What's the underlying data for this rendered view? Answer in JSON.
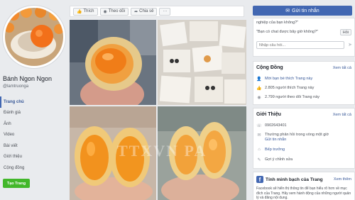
{
  "page": {
    "name": "Bánh Ngon Ngon",
    "handle": "@lamtruonga"
  },
  "nav": {
    "items": [
      {
        "label": "Trang chủ",
        "active": true
      },
      {
        "label": "Đánh giá"
      },
      {
        "label": "Ảnh"
      },
      {
        "label": "Video"
      },
      {
        "label": "Bài viết"
      },
      {
        "label": "Giới thiệu"
      },
      {
        "label": "Cộng đồng"
      }
    ],
    "create_button": "Tạo Trang"
  },
  "actions": {
    "like": "Thích",
    "follow": "Theo dõi",
    "share": "Chia sẻ",
    "more": "···"
  },
  "watermark": "TTXVN PA",
  "messenger": {
    "send_button": "Gửi tin nhắn",
    "q1": "nghiệp của bạn không?\"",
    "q2": "\"Bạn có chat được bây giờ không?\"",
    "ask_button": "Hỏi",
    "input_placeholder": "Nhập câu hỏi..."
  },
  "community": {
    "title": "Cộng Đồng",
    "see_all": "Xem tất cả",
    "invite": "Mời bạn bè thích Trang này",
    "likes": "2.805 người thích Trang này",
    "follows": "2.799 người theo dõi Trang này"
  },
  "about": {
    "title": "Giới Thiệu",
    "see_all": "Xem tất cả",
    "phone": "0902643401",
    "response": "Thường phản hồi trong vòng một giờ",
    "send_message": "Gửi tin nhắn",
    "category": "Bếp trưởng",
    "suggest": "Gợi ý chỉnh sửa"
  },
  "transparency": {
    "title": "Tính minh bạch của Trang",
    "see_more": "Xem thêm",
    "body": "Facebook sẽ hiển thị thông tin để bạn hiểu rõ hơn về mục đích của Trang. Hãy xem hành động của những người quản lý và đăng nội dung."
  },
  "colors": {
    "brand_blue": "#4267b2",
    "link_blue": "#385898",
    "green": "#42b72a",
    "background": "#e9ebee"
  }
}
